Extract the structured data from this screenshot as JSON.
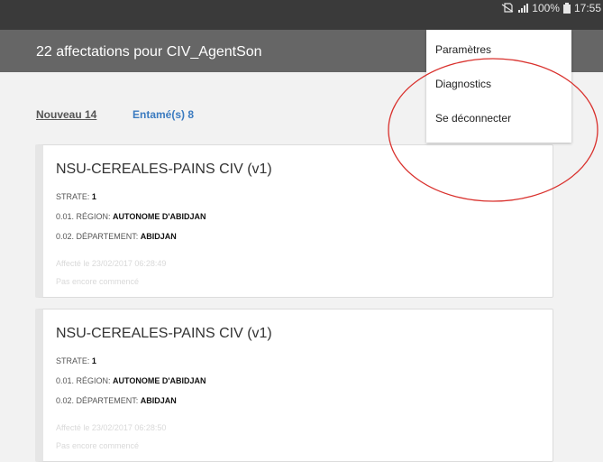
{
  "status_bar": {
    "battery": "100%",
    "time": "17:55"
  },
  "header": {
    "title": "22 affectations pour CIV_AgentSon"
  },
  "tabs": {
    "new_label": "Nouveau 14",
    "started_label": "Entamé(s) 8"
  },
  "menu": {
    "items": [
      "Paramètres",
      "Diagnostics",
      "Se déconnecter"
    ]
  },
  "cards": [
    {
      "title": "NSU-CEREALES-PAINS CIV (v1)",
      "strata_label": "STRATE:",
      "strata_value": "1",
      "region_label": "0.01. RÉGION:",
      "region_value": "AUTONOME D'ABIDJAN",
      "department_label": "0.02. DÉPARTEMENT:",
      "department_value": "ABIDJAN",
      "assigned": "Affecté le 23/02/2017 06:28:49",
      "status": "Pas encore commencé"
    },
    {
      "title": "NSU-CEREALES-PAINS CIV (v1)",
      "strata_label": "STRATE:",
      "strata_value": "1",
      "region_label": "0.01. RÉGION:",
      "region_value": "AUTONOME D'ABIDJAN",
      "department_label": "0.02. DÉPARTEMENT:",
      "department_value": "ABIDJAN",
      "assigned": "Affecté le 23/02/2017 06:28:50",
      "status": "Pas encore commencé"
    }
  ],
  "colors": {
    "statusbar": "#3a3a3a",
    "appbar": "#666666",
    "accent": "#3b7bc0",
    "annotation": "#d9302c"
  },
  "icons": [
    "no-sim-icon",
    "signal-icon",
    "battery-icon"
  ]
}
